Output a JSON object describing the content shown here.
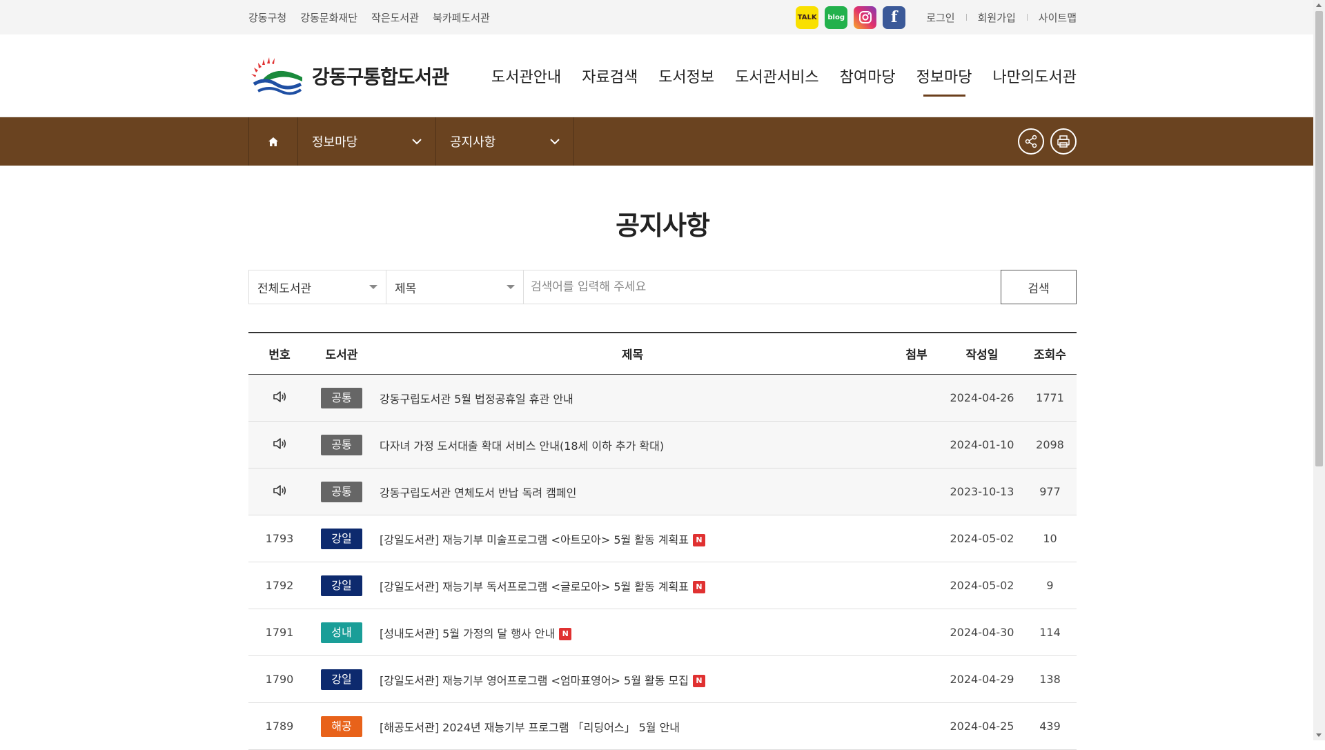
{
  "top_links": [
    "강동구청",
    "강동문화재단",
    "작은도서관",
    "북카페도서관"
  ],
  "sns": {
    "kakao": "TALK",
    "blog": "blog",
    "instagram_icon": "instagram-icon",
    "facebook": "f"
  },
  "account": {
    "login": "로그인",
    "join": "회원가입",
    "sitemap": "사이트맵"
  },
  "logo": {
    "text": "강동구통합도서관"
  },
  "gnb": [
    "도서관안내",
    "자료검색",
    "도서정보",
    "도서관서비스",
    "참여마당",
    "정보마당",
    "나만의도서관"
  ],
  "gnb_active_index": 5,
  "location": {
    "home_icon": "home-icon",
    "depth1": "정보마당",
    "depth2": "공지사항"
  },
  "page_title": "공지사항",
  "search": {
    "library_select": "전체도서관",
    "field_select": "제목",
    "placeholder": "검색어를 입력해 주세요",
    "button": "검색"
  },
  "table": {
    "headers": [
      "번호",
      "도서관",
      "제목",
      "첨부",
      "작성일",
      "조회수"
    ],
    "rows": [
      {
        "no": "",
        "notice": true,
        "lib": "공통",
        "title": "강동구립도서관 5월 법정공휴일 휴관 안내",
        "new": false,
        "date": "2024-04-26",
        "views": "1771"
      },
      {
        "no": "",
        "notice": true,
        "lib": "공통",
        "title": "다자녀 가정 도서대출 확대 서비스 안내(18세 이하 추가 확대)",
        "new": false,
        "date": "2024-01-10",
        "views": "2098"
      },
      {
        "no": "",
        "notice": true,
        "lib": "공통",
        "title": "강동구립도서관 연체도서 반납 독려 캠페인",
        "new": false,
        "date": "2023-10-13",
        "views": "977"
      },
      {
        "no": "1793",
        "notice": false,
        "lib": "강일",
        "title": "[강일도서관] 재능기부 미술프로그램 <아트모아> 5월 활동 계획표",
        "new": true,
        "date": "2024-05-02",
        "views": "10"
      },
      {
        "no": "1792",
        "notice": false,
        "lib": "강일",
        "title": "[강일도서관] 재능기부 독서프로그램 <글로모아> 5월 활동 계획표",
        "new": true,
        "date": "2024-05-02",
        "views": "9"
      },
      {
        "no": "1791",
        "notice": false,
        "lib": "성내",
        "title": "[성내도서관] 5월 가정의 달 행사 안내",
        "new": true,
        "date": "2024-04-30",
        "views": "114"
      },
      {
        "no": "1790",
        "notice": false,
        "lib": "강일",
        "title": "[강일도서관] 재능기부 영어프로그램 <엄마표영어> 5월 활동 모집",
        "new": true,
        "date": "2024-04-29",
        "views": "138"
      },
      {
        "no": "1789",
        "notice": false,
        "lib": "해공",
        "title": "[해공도서관] 2024년 재능기부 프로그램 「리딩어스」 5월 안내",
        "new": false,
        "date": "2024-04-25",
        "views": "439"
      }
    ],
    "new_mark": "N"
  },
  "colors": {
    "brown_bar": "#6a4320",
    "badge_common": "#666666",
    "badge_gangil": "#0d2a6e",
    "badge_seongnae": "#1a9e98",
    "badge_haegong": "#e8621a",
    "new_mark": "#e03131"
  }
}
